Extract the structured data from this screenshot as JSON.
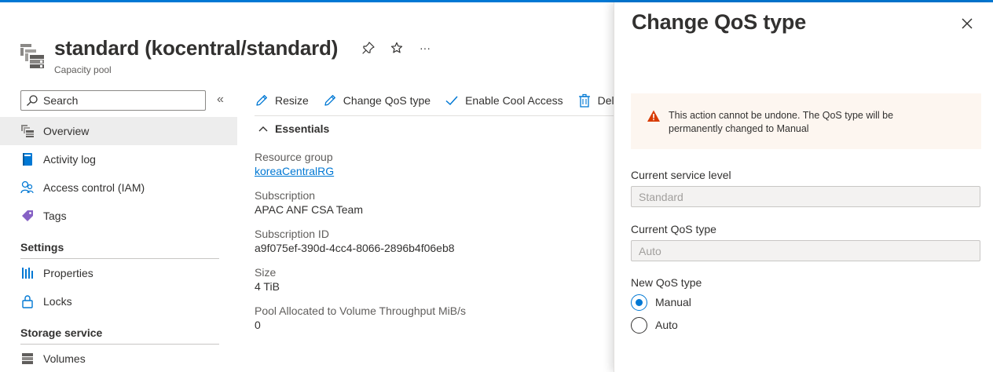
{
  "header": {
    "title": "standard (kocentral/standard)",
    "subtitle": "Capacity pool",
    "more_label": "···"
  },
  "search": {
    "placeholder": "Search"
  },
  "collapse_label": "«",
  "nav": {
    "items_top": [
      {
        "label": "Overview",
        "icon": "capacity-pool-icon"
      },
      {
        "label": "Activity log",
        "icon": "activity-log-icon"
      },
      {
        "label": "Access control (IAM)",
        "icon": "iam-icon"
      },
      {
        "label": "Tags",
        "icon": "tag-icon"
      }
    ],
    "settings_label": "Settings",
    "settings_items": [
      {
        "label": "Properties",
        "icon": "properties-icon"
      },
      {
        "label": "Locks",
        "icon": "lock-icon"
      }
    ],
    "storage_label": "Storage service",
    "storage_items": [
      {
        "label": "Volumes",
        "icon": "volumes-icon"
      }
    ]
  },
  "commands": {
    "resize": "Resize",
    "change_qos": "Change QoS type",
    "enable_cool": "Enable Cool Access",
    "delete": "Delete"
  },
  "essentials": {
    "label": "Essentials",
    "props": [
      {
        "label": "Resource group",
        "value": "koreaCentralRG",
        "link": true
      },
      {
        "label": "Subscription",
        "value": "APAC ANF CSA Team",
        "link": false
      },
      {
        "label": "Subscription ID",
        "value": "a9f075ef-390d-4cc4-8066-2896b4f06eb8",
        "link": false
      },
      {
        "label": "Size",
        "value": "4 TiB",
        "link": false
      },
      {
        "label": "Pool Allocated to Volume Throughput MiB/s",
        "value": "0",
        "link": false
      }
    ]
  },
  "blade": {
    "title": "Change QoS type",
    "warning": "This action cannot be undone. The QoS type will be permanently changed to Manual",
    "current_service_level_label": "Current service level",
    "current_service_level_value": "Standard",
    "current_qos_label": "Current QoS type",
    "current_qos_value": "Auto",
    "new_qos_label": "New QoS type",
    "options": [
      {
        "label": "Manual",
        "selected": true
      },
      {
        "label": "Auto",
        "selected": false
      }
    ]
  },
  "colors": {
    "accent": "#0078d4",
    "warning_bg": "#fdf6f0",
    "warning_icon": "#d83b01"
  }
}
